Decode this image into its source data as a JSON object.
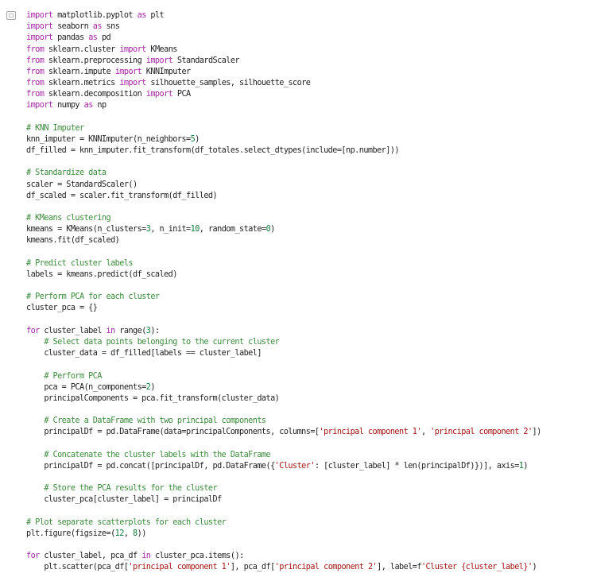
{
  "notebook": {
    "cell": {
      "gutter_icon": "collapse-cell-icon",
      "code_lines": [
        [
          [
            "kw",
            "import"
          ],
          [
            "pl",
            " matplotlib.pyplot "
          ],
          [
            "kw",
            "as"
          ],
          [
            "pl",
            " plt"
          ]
        ],
        [
          [
            "kw",
            "import"
          ],
          [
            "pl",
            " seaborn "
          ],
          [
            "kw",
            "as"
          ],
          [
            "pl",
            " sns"
          ]
        ],
        [
          [
            "kw",
            "import"
          ],
          [
            "pl",
            " pandas "
          ],
          [
            "kw",
            "as"
          ],
          [
            "pl",
            " pd"
          ]
        ],
        [
          [
            "kw",
            "from"
          ],
          [
            "pl",
            " sklearn.cluster "
          ],
          [
            "kw",
            "import"
          ],
          [
            "pl",
            " KMeans"
          ]
        ],
        [
          [
            "kw",
            "from"
          ],
          [
            "pl",
            " sklearn.preprocessing "
          ],
          [
            "kw",
            "import"
          ],
          [
            "pl",
            " StandardScaler"
          ]
        ],
        [
          [
            "kw",
            "from"
          ],
          [
            "pl",
            " sklearn.impute "
          ],
          [
            "kw",
            "import"
          ],
          [
            "pl",
            " KNNImputer"
          ]
        ],
        [
          [
            "kw",
            "from"
          ],
          [
            "pl",
            " sklearn.metrics "
          ],
          [
            "kw",
            "import"
          ],
          [
            "pl",
            " silhouette_samples, silhouette_score"
          ]
        ],
        [
          [
            "kw",
            "from"
          ],
          [
            "pl",
            " sklearn.decomposition "
          ],
          [
            "kw",
            "import"
          ],
          [
            "pl",
            " PCA"
          ]
        ],
        [
          [
            "kw",
            "import"
          ],
          [
            "pl",
            " numpy "
          ],
          [
            "kw",
            "as"
          ],
          [
            "pl",
            " np"
          ]
        ],
        [],
        [
          [
            "cm",
            "# KNN Imputer"
          ]
        ],
        [
          [
            "pl",
            "knn_imputer = KNNImputer(n_neighbors="
          ],
          [
            "num",
            "5"
          ],
          [
            "pl",
            ")"
          ]
        ],
        [
          [
            "pl",
            "df_filled = knn_imputer.fit_transform(df_totales.select_dtypes(include=[np.number]))"
          ]
        ],
        [],
        [
          [
            "cm",
            "# Standardize data"
          ]
        ],
        [
          [
            "pl",
            "scaler = StandardScaler()"
          ]
        ],
        [
          [
            "pl",
            "df_scaled = scaler.fit_transform(df_filled)"
          ]
        ],
        [],
        [
          [
            "cm",
            "# KMeans clustering"
          ]
        ],
        [
          [
            "pl",
            "kmeans = KMeans(n_clusters="
          ],
          [
            "num",
            "3"
          ],
          [
            "pl",
            ", n_init="
          ],
          [
            "num",
            "10"
          ],
          [
            "pl",
            ", random_state="
          ],
          [
            "num",
            "0"
          ],
          [
            "pl",
            ")"
          ]
        ],
        [
          [
            "pl",
            "kmeans.fit(df_scaled)"
          ]
        ],
        [],
        [
          [
            "cm",
            "# Predict cluster labels"
          ]
        ],
        [
          [
            "pl",
            "labels = kmeans.predict(df_scaled)"
          ]
        ],
        [],
        [
          [
            "cm",
            "# Perform PCA for each cluster"
          ]
        ],
        [
          [
            "pl",
            "cluster_pca = {}"
          ]
        ],
        [],
        [
          [
            "kw",
            "for"
          ],
          [
            "pl",
            " cluster_label "
          ],
          [
            "kw",
            "in"
          ],
          [
            "pl",
            " range("
          ],
          [
            "num",
            "3"
          ],
          [
            "pl",
            "):"
          ]
        ],
        [
          [
            "pl",
            "    "
          ],
          [
            "cm",
            "# Select data points belonging to the current cluster"
          ]
        ],
        [
          [
            "pl",
            "    cluster_data = df_filled[labels == cluster_label]"
          ]
        ],
        [],
        [
          [
            "pl",
            "    "
          ],
          [
            "cm",
            "# Perform PCA"
          ]
        ],
        [
          [
            "pl",
            "    pca = PCA(n_components="
          ],
          [
            "num",
            "2"
          ],
          [
            "pl",
            ")"
          ]
        ],
        [
          [
            "pl",
            "    principalComponents = pca.fit_transform(cluster_data)"
          ]
        ],
        [],
        [
          [
            "pl",
            "    "
          ],
          [
            "cm",
            "# Create a DataFrame with two principal components"
          ]
        ],
        [
          [
            "pl",
            "    principalDf = pd.DataFrame(data=principalComponents, columns=["
          ],
          [
            "str",
            "'principal component 1'"
          ],
          [
            "pl",
            ", "
          ],
          [
            "str",
            "'principal component 2'"
          ],
          [
            "pl",
            "])"
          ]
        ],
        [],
        [
          [
            "pl",
            "    "
          ],
          [
            "cm",
            "# Concatenate the cluster labels with the DataFrame"
          ]
        ],
        [
          [
            "pl",
            "    principalDf = pd.concat([principalDf, pd.DataFrame({"
          ],
          [
            "str",
            "'Cluster'"
          ],
          [
            "pl",
            ": [cluster_label] * len(principalDf)})], axis="
          ],
          [
            "num",
            "1"
          ],
          [
            "pl",
            ")"
          ]
        ],
        [],
        [
          [
            "pl",
            "    "
          ],
          [
            "cm",
            "# Store the PCA results for the cluster"
          ]
        ],
        [
          [
            "pl",
            "    cluster_pca[cluster_label] = principalDf"
          ]
        ],
        [],
        [
          [
            "cm",
            "# Plot separate scatterplots for each cluster"
          ]
        ],
        [
          [
            "pl",
            "plt.figure(figsize=("
          ],
          [
            "num",
            "12"
          ],
          [
            "pl",
            ", "
          ],
          [
            "num",
            "8"
          ],
          [
            "pl",
            "))"
          ]
        ],
        [],
        [
          [
            "kw",
            "for"
          ],
          [
            "pl",
            " cluster_label, pca_df "
          ],
          [
            "kw",
            "in"
          ],
          [
            "pl",
            " cluster_pca.items():"
          ]
        ],
        [
          [
            "pl",
            "    plt.scatter(pca_df["
          ],
          [
            "str",
            "'principal component 1'"
          ],
          [
            "pl",
            "], pca_df["
          ],
          [
            "str",
            "'principal component 2'"
          ],
          [
            "pl",
            "], label=f"
          ],
          [
            "str",
            "'Cluster {cluster_label}'"
          ],
          [
            "pl",
            ")"
          ]
        ]
      ]
    }
  },
  "colors": {
    "keyword": "#a626a4",
    "comment": "#3c8a3c",
    "number": "#0f7a3a",
    "string": "#a31515",
    "text": "#1f1f1f"
  }
}
